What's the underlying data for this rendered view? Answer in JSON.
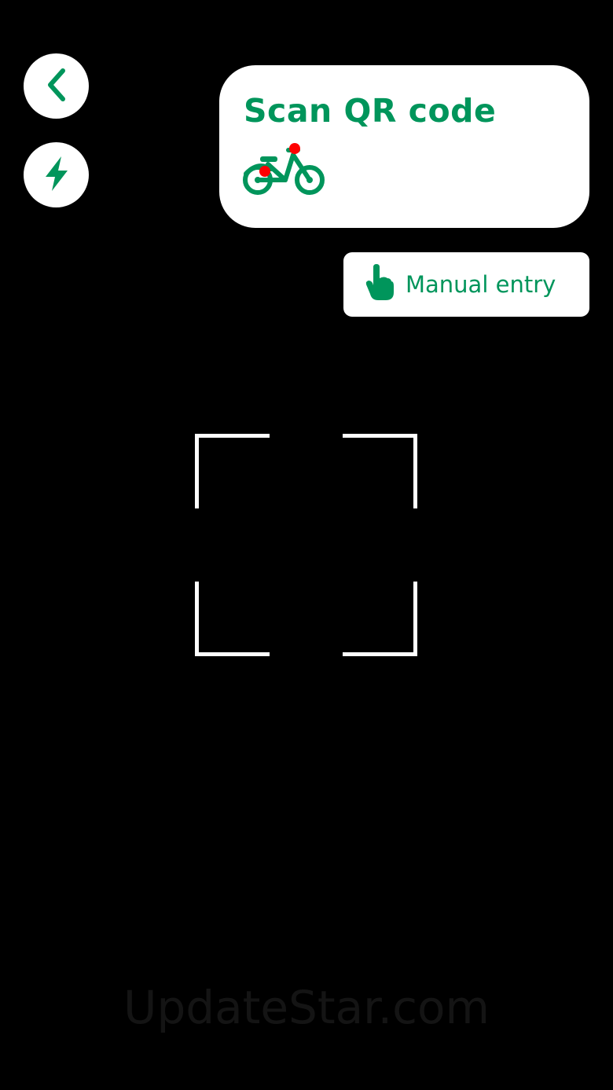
{
  "toolbar": {
    "back_icon": "chevron-left-icon",
    "flash_icon": "lightning-bolt-icon"
  },
  "scan_card": {
    "title": "Scan QR code",
    "icon": "bike-icon"
  },
  "manual_entry": {
    "label": "Manual entry",
    "icon": "pointing-hand-icon"
  },
  "watermark": {
    "text": "UpdateStar.com"
  },
  "colors": {
    "brand_green": "#00955b",
    "accent_red": "#ff0000",
    "background": "#000000",
    "surface": "#ffffff"
  }
}
